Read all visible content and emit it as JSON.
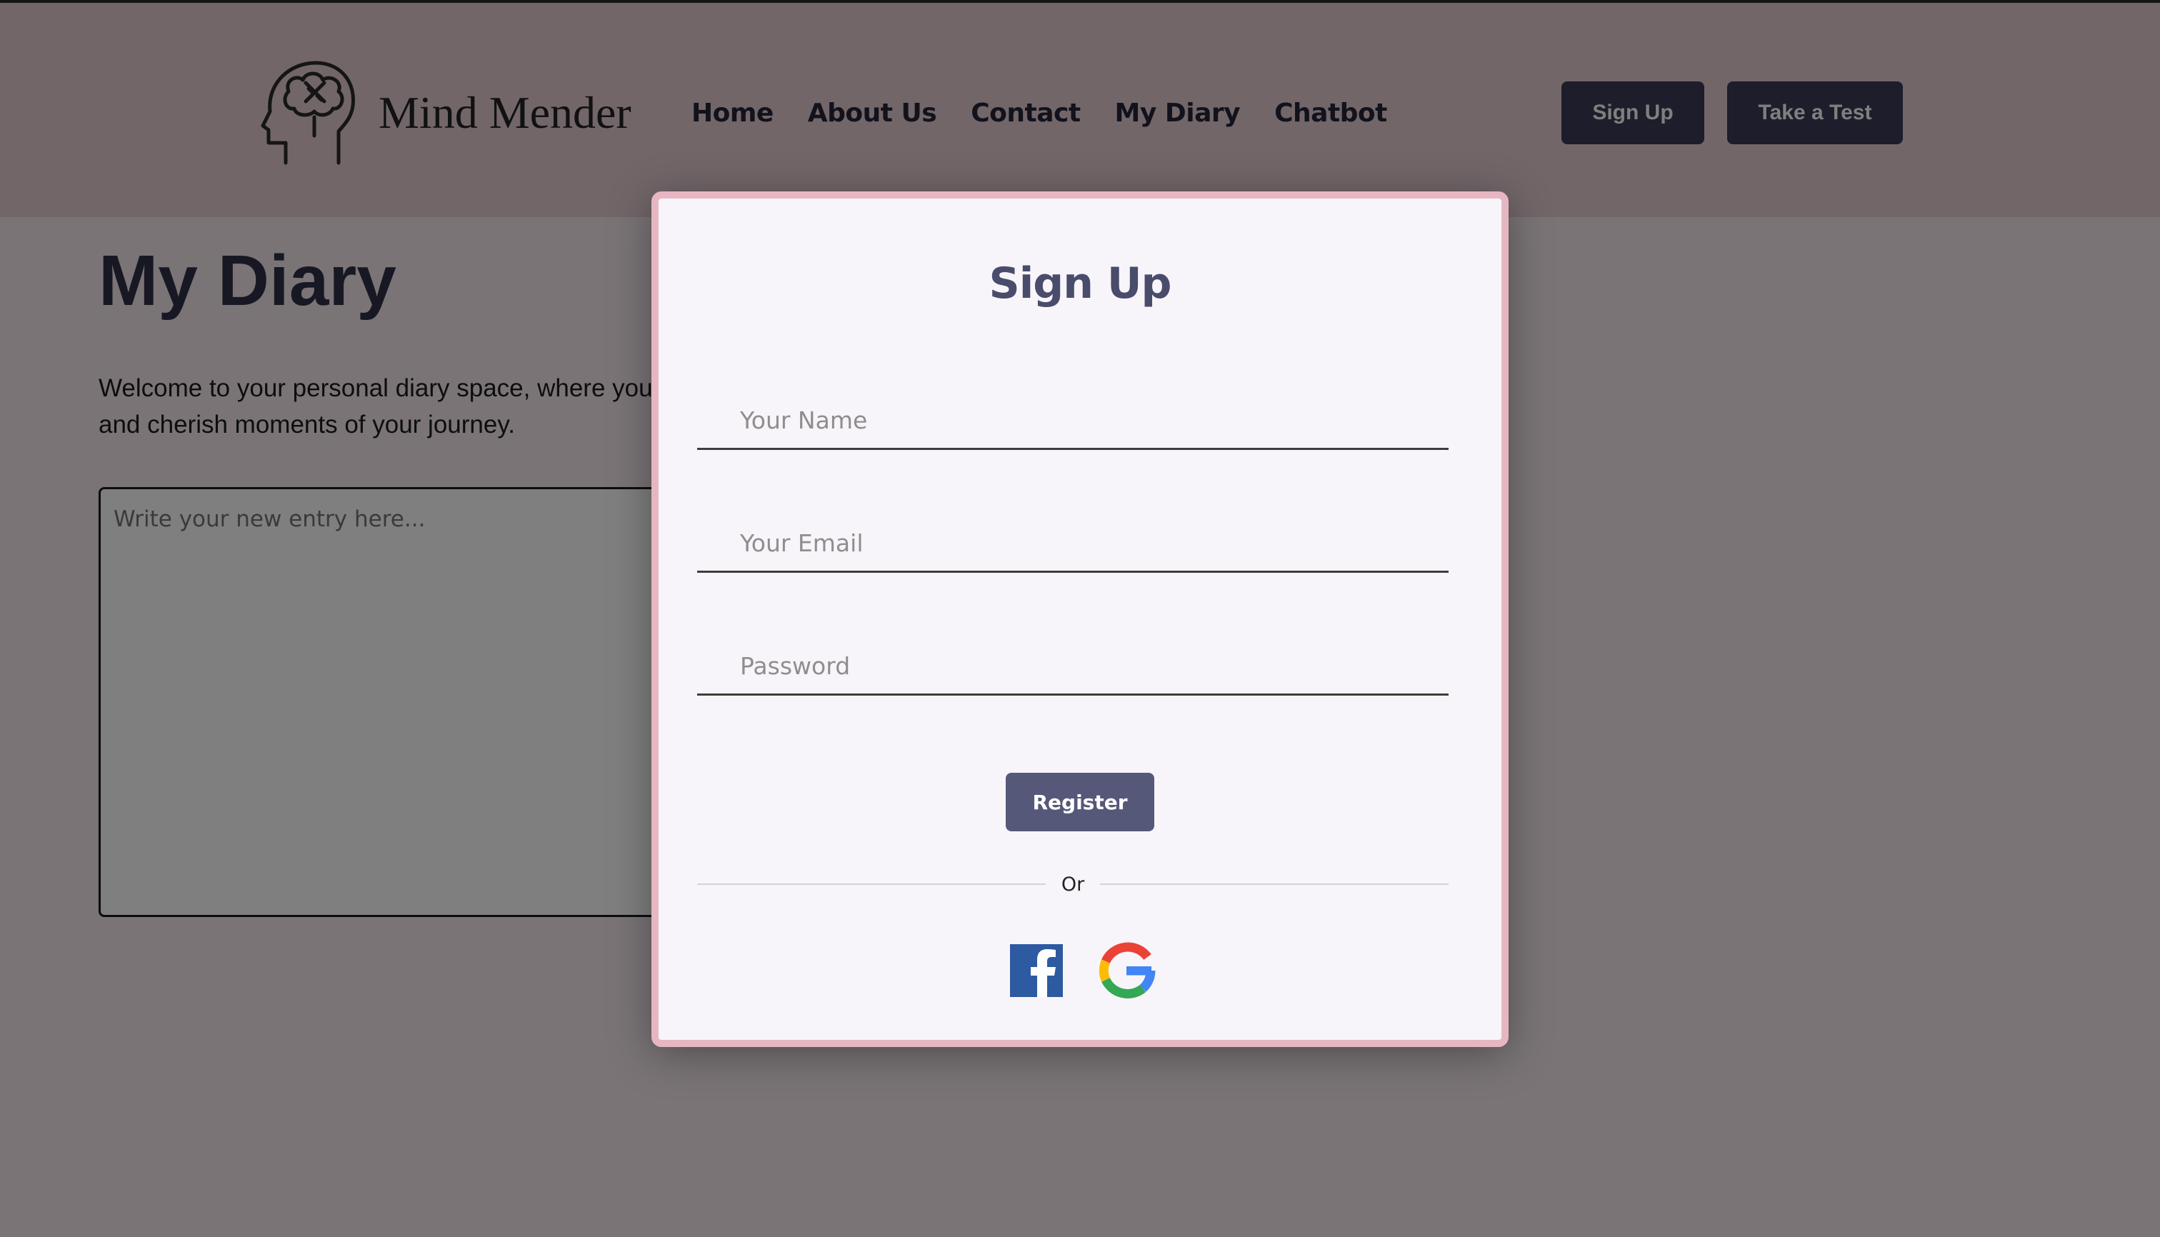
{
  "header": {
    "logo_text": "Mind Mender",
    "nav": [
      "Home",
      "About Us",
      "Contact",
      "My Diary",
      "Chatbot"
    ],
    "signup_button": "Sign Up",
    "test_button": "Take a Test"
  },
  "diary": {
    "title": "My Diary",
    "intro": "Welcome to your personal diary space, where you can reflect on your day, jot down thoughts, and cherish moments of your journey.",
    "entry_placeholder": "Write your new entry here..."
  },
  "modal": {
    "title": "Sign Up",
    "name_placeholder": "Your Name",
    "email_placeholder": "Your Email",
    "password_placeholder": "Password",
    "register_button": "Register",
    "divider_text": "Or"
  },
  "colors": {
    "accent": "#3a3a56",
    "modal_border": "#e6b7c2",
    "register": "#555879",
    "facebook": "#2d5aa0"
  },
  "icons": {
    "logo": "head-brain-bandage-icon",
    "facebook": "facebook-icon",
    "google": "google-icon"
  }
}
